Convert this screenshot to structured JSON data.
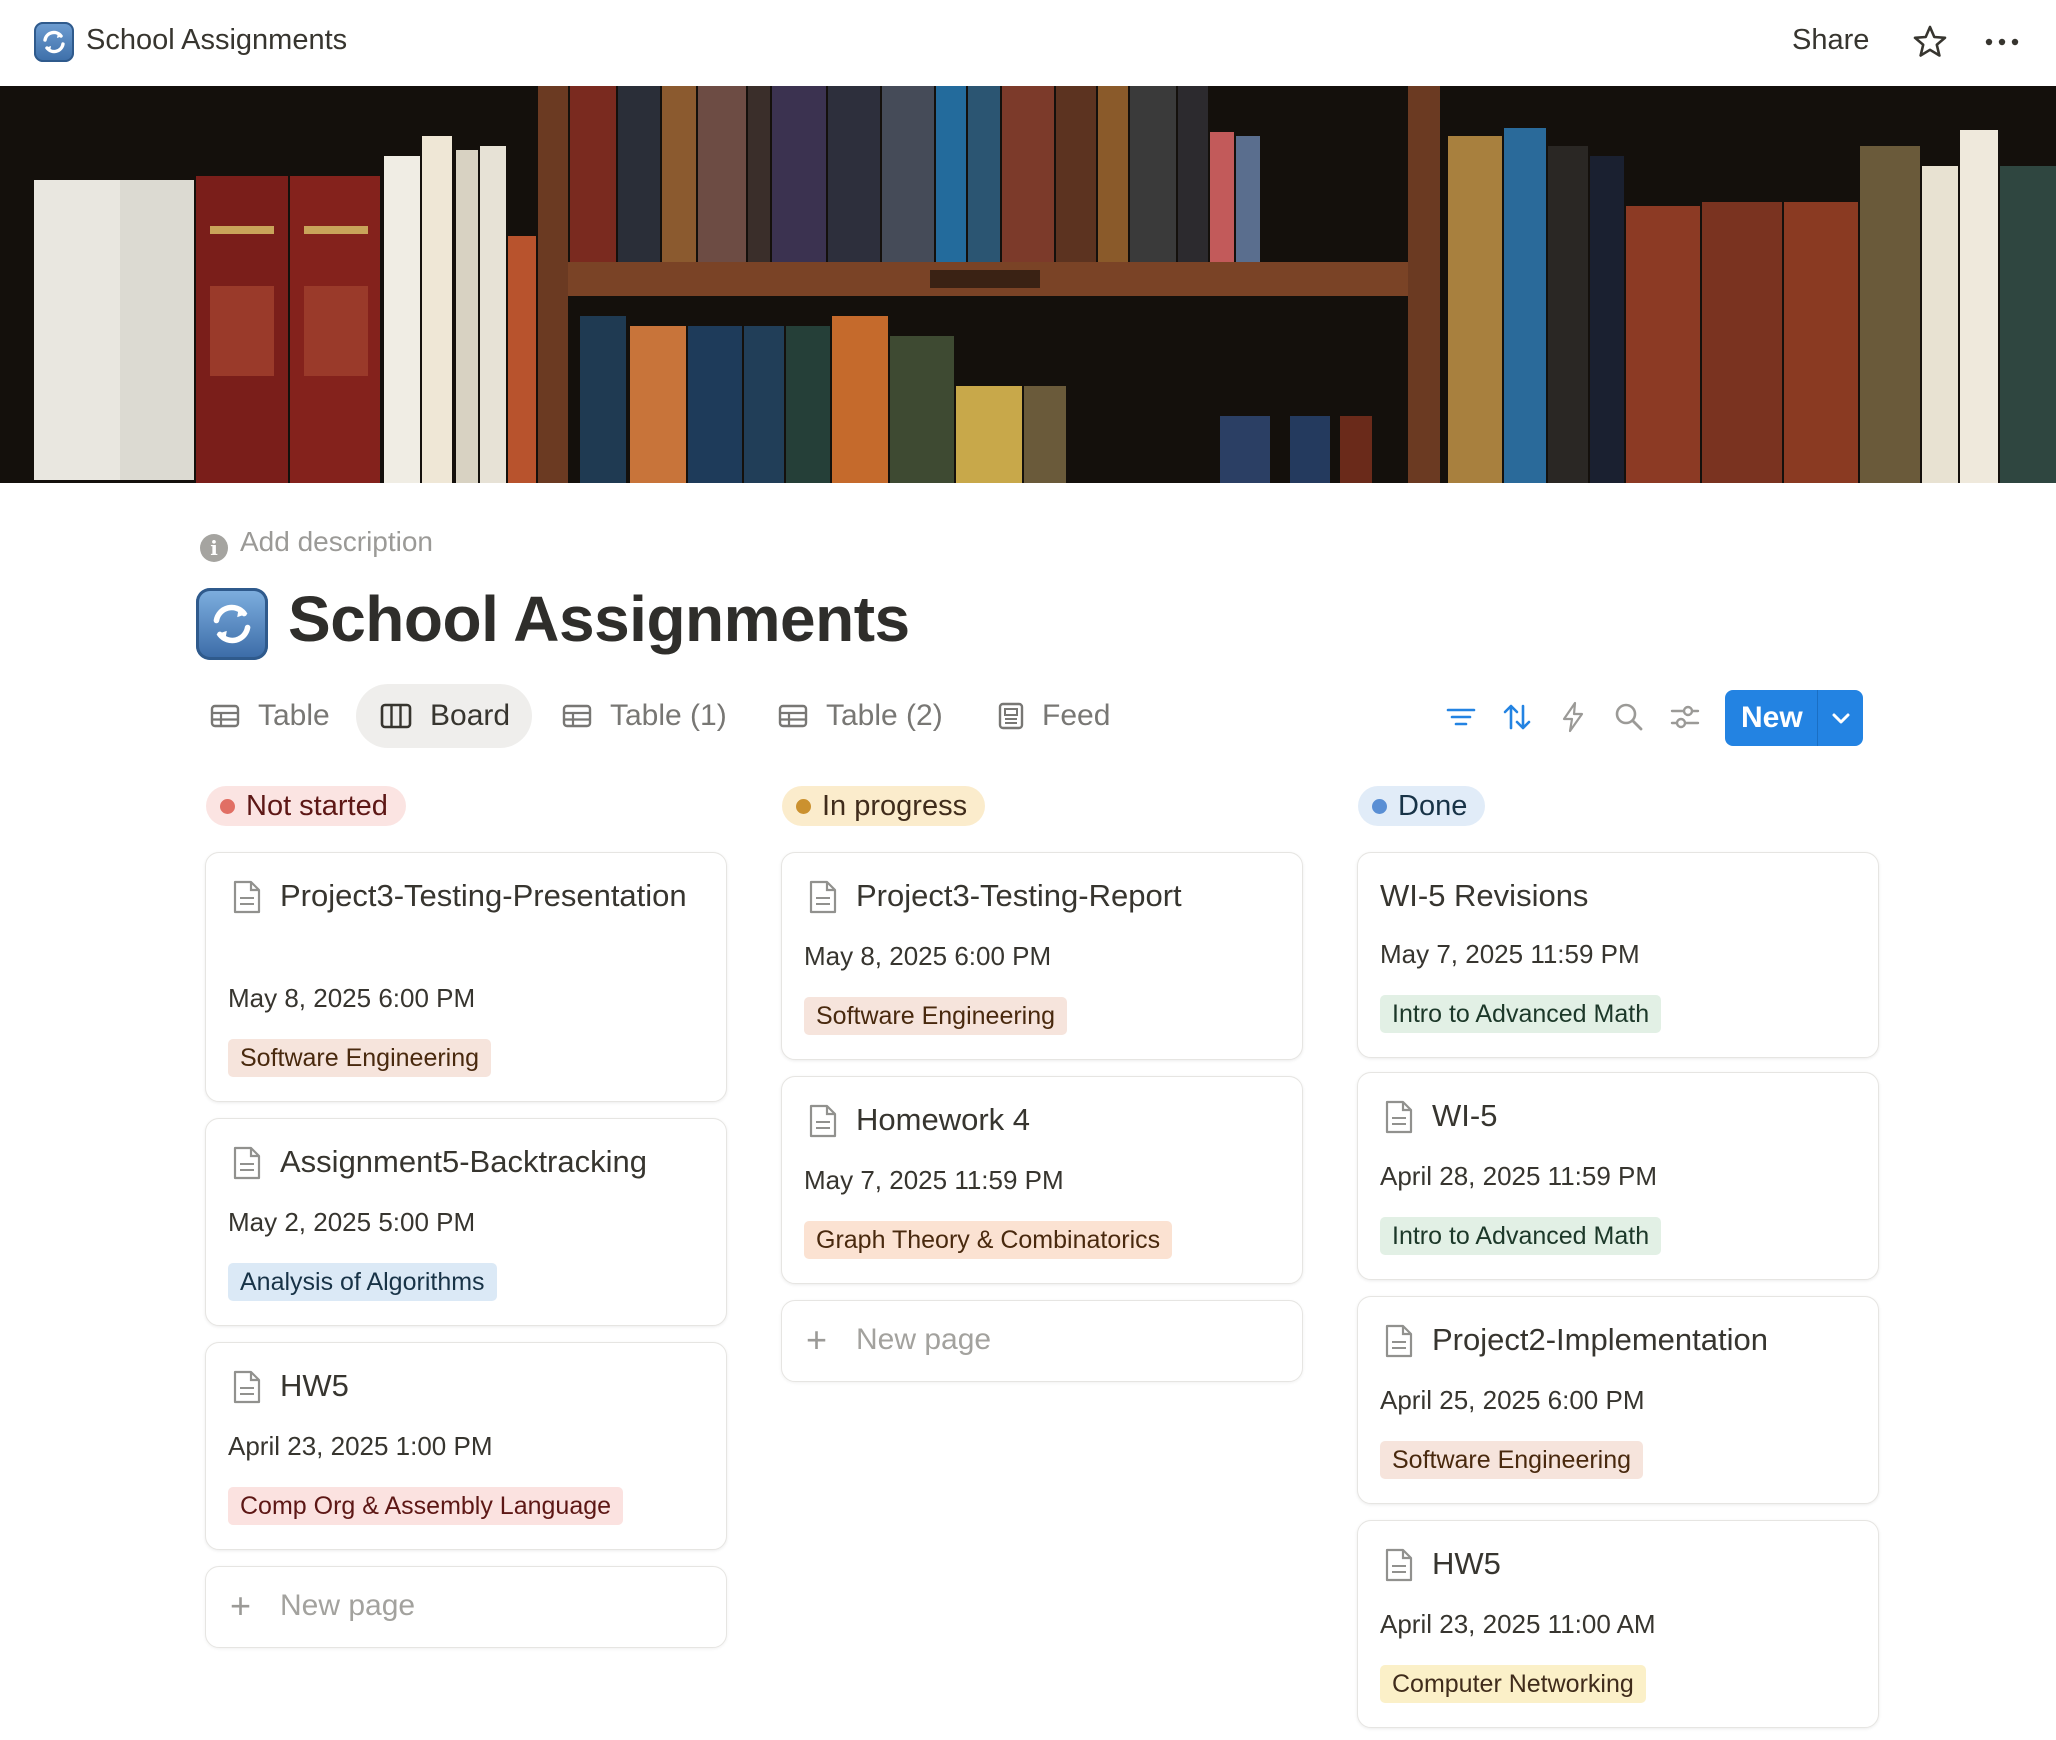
{
  "topbar": {
    "title": "School Assignments",
    "share_label": "Share"
  },
  "description_placeholder": "Add description",
  "page_title": "School Assignments",
  "tabs": [
    {
      "label": "Table",
      "icon": "table-icon",
      "active": false
    },
    {
      "label": "Board",
      "icon": "board-icon",
      "active": true
    },
    {
      "label": "Table (1)",
      "icon": "table-icon",
      "active": false
    },
    {
      "label": "Table (2)",
      "icon": "table-icon",
      "active": false
    },
    {
      "label": "Feed",
      "icon": "feed-icon",
      "active": false
    }
  ],
  "toolbar": {
    "icons": [
      "filter-icon",
      "sort-icon",
      "automation-icon",
      "search-icon",
      "settings-icon"
    ],
    "new_label": "New",
    "accent": "#2383e2"
  },
  "columns": [
    {
      "name": "Not started",
      "dot_color": "#e16f64",
      "bg": "#fbe4e2",
      "text_color": "#5d1715",
      "cards": [
        {
          "title": "Project3-Testing-Presentation",
          "date": "May 8, 2025 6:00 PM",
          "tag": "Software Engineering"
        },
        {
          "title": "Assignment5-Backtracking",
          "date": "May 2, 2025 5:00 PM",
          "tag": "Analysis of Algorithms"
        },
        {
          "title": "HW5",
          "date": "April 23, 2025 1:00 PM",
          "tag": "Comp Org & Assembly Language"
        }
      ],
      "new_page": "New page"
    },
    {
      "name": "In progress",
      "dot_color": "#cb912f",
      "bg": "#fbeccc",
      "text_color": "#402c1b",
      "cards": [
        {
          "title": "Project3-Testing-Report",
          "date": "May 8, 2025 6:00 PM",
          "tag": "Software Engineering"
        },
        {
          "title": "Homework 4",
          "date": "May 7, 2025 11:59 PM",
          "tag": "Graph Theory & Combinatorics"
        }
      ],
      "new_page": "New page"
    },
    {
      "name": "Done",
      "dot_color": "#5a8fd4",
      "bg": "#e1ecf8",
      "text_color": "#183347",
      "cards": [
        {
          "title": "WI-5 Revisions",
          "date": "May 7, 2025 11:59 PM",
          "tag": "Intro to Advanced Math"
        },
        {
          "title": "WI-5",
          "date": "April 28, 2025 11:59 PM",
          "tag": "Intro to Advanced Math"
        },
        {
          "title": "Project2-Implementation",
          "date": "April 25, 2025 6:00 PM",
          "tag": "Software Engineering"
        },
        {
          "title": "HW5",
          "date": "April 23, 2025 11:00 AM",
          "tag": "Computer Networking"
        }
      ]
    }
  ],
  "tag_colors": {
    "Software Engineering": {
      "bg": "#f6e4dc",
      "fg": "#49290e"
    },
    "Analysis of Algorithms": {
      "bg": "#dbe9f6",
      "fg": "#183347"
    },
    "Comp Org & Assembly Language": {
      "bg": "#fbe2e0",
      "fg": "#5d1715"
    },
    "Graph Theory & Combinatorics": {
      "bg": "#fbe2d2",
      "fg": "#49290e"
    },
    "Intro to Advanced Math": {
      "bg": "#e2f0e5",
      "fg": "#1c3829"
    },
    "Computer Networking": {
      "bg": "#fbf0c8",
      "fg": "#402c1b"
    }
  }
}
